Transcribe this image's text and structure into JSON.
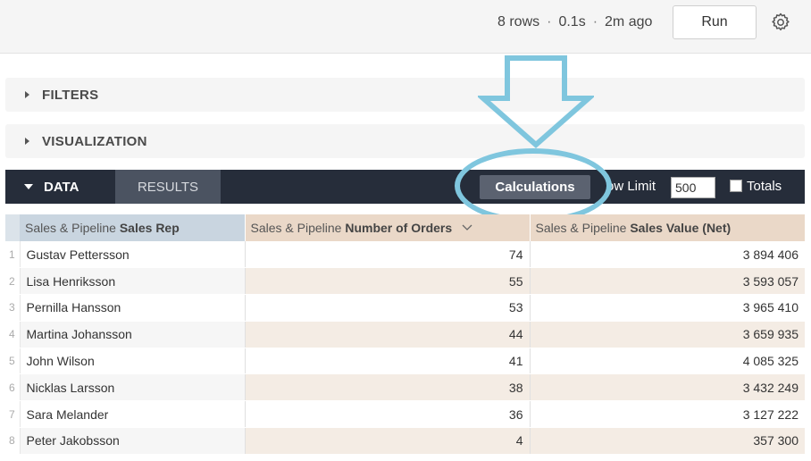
{
  "header": {
    "rows": "8 rows",
    "time": "0.1s",
    "ago": "2m ago",
    "separator": "·",
    "run_label": "Run"
  },
  "sections": {
    "filters": "FILTERS",
    "visualization": "VISUALIZATION"
  },
  "data_bar": {
    "data_tab": "DATA",
    "results_tab": "RESULTS",
    "calculations": "Calculations",
    "row_limit_label": "ow Limit",
    "row_limit_value": "500",
    "totals_label": "Totals"
  },
  "table": {
    "columns": [
      {
        "prefix": "Sales & Pipeline ",
        "bold": "Sales Rep"
      },
      {
        "prefix": "Sales & Pipeline ",
        "bold": "Number of Orders"
      },
      {
        "prefix": "Sales & Pipeline ",
        "bold": "Sales Value (Net)"
      }
    ],
    "rows": [
      {
        "n": "1",
        "name": "Gustav Pettersson",
        "orders": "74",
        "value": "3 894 406"
      },
      {
        "n": "2",
        "name": "Lisa Henriksson",
        "orders": "55",
        "value": "3 593 057"
      },
      {
        "n": "3",
        "name": "Pernilla Hansson",
        "orders": "53",
        "value": "3 965 410"
      },
      {
        "n": "4",
        "name": "Martina Johansson",
        "orders": "44",
        "value": "3 659 935"
      },
      {
        "n": "5",
        "name": "John Wilson",
        "orders": "41",
        "value": "4 085 325"
      },
      {
        "n": "6",
        "name": "Nicklas Larsson",
        "orders": "38",
        "value": "3 432 249"
      },
      {
        "n": "7",
        "name": "Sara Melander",
        "orders": "36",
        "value": "3 127 222"
      },
      {
        "n": "8",
        "name": "Peter Jakobsson",
        "orders": "4",
        "value": "357 300"
      }
    ]
  },
  "icons": {
    "settings": "gear-icon",
    "sort": "chevron-down-icon",
    "section_toggle": "caret-right-icon",
    "annotation_arrow": "arrow-down-icon"
  },
  "colors": {
    "accent_annotation": "#7fc6de",
    "data_bar": "#262d3a",
    "dimension_header": "#c9d5e0",
    "measure_header": "#ead8c8"
  }
}
